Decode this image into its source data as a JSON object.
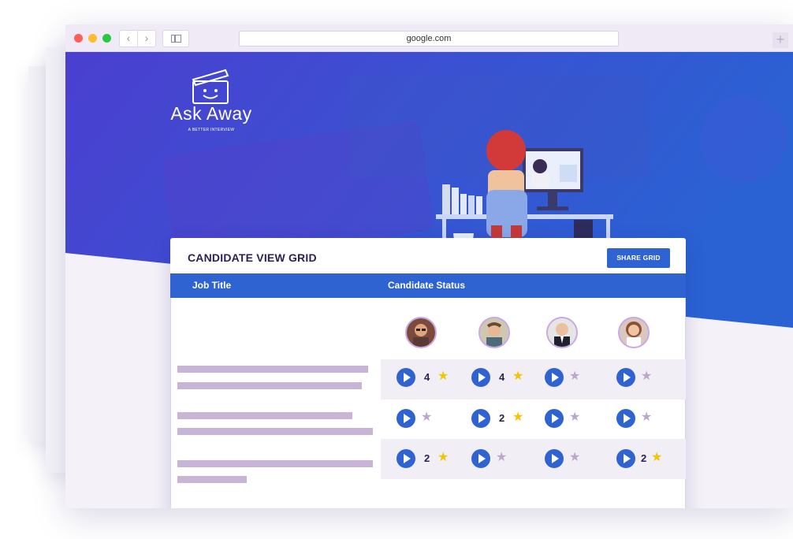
{
  "browser": {
    "url": "google.com",
    "back_label": "‹",
    "forward_label": "›",
    "new_tab_label": "+"
  },
  "brand": {
    "name": "Ask Away",
    "tagline": "A BETTER INTERVIEW"
  },
  "card": {
    "title": "CANDIDATE VIEW GRID",
    "share_button": "SHARE GRID",
    "columns": {
      "job_title": "Job Title",
      "candidate_status": "Candidate Status"
    }
  },
  "colors": {
    "primary": "#2f63d1",
    "hero_gradient_start": "#4b3fd0",
    "hero_gradient_end": "#2a62d3",
    "star_rated": "#f4c400",
    "star_unrated": "#b9a8cc",
    "placeholder_bar": "#c8b4d6"
  },
  "candidates": [
    {
      "icon": "avatar-man-glasses"
    },
    {
      "icon": "avatar-man-smiling"
    },
    {
      "icon": "avatar-man-suit"
    },
    {
      "icon": "avatar-woman"
    }
  ],
  "rows": [
    {
      "cells": [
        {
          "score": "4",
          "rated": true
        },
        {
          "score": "4",
          "rated": true
        },
        {
          "score": "",
          "rated": false
        },
        {
          "score": "",
          "rated": false
        }
      ]
    },
    {
      "cells": [
        {
          "score": "",
          "rated": false
        },
        {
          "score": "2",
          "rated": true
        },
        {
          "score": "",
          "rated": false
        },
        {
          "score": "",
          "rated": false
        }
      ]
    },
    {
      "cells": [
        {
          "score": "2",
          "rated": true
        },
        {
          "score": "",
          "rated": false
        },
        {
          "score": "",
          "rated": false
        },
        {
          "score": "2",
          "rated": true
        }
      ]
    }
  ]
}
